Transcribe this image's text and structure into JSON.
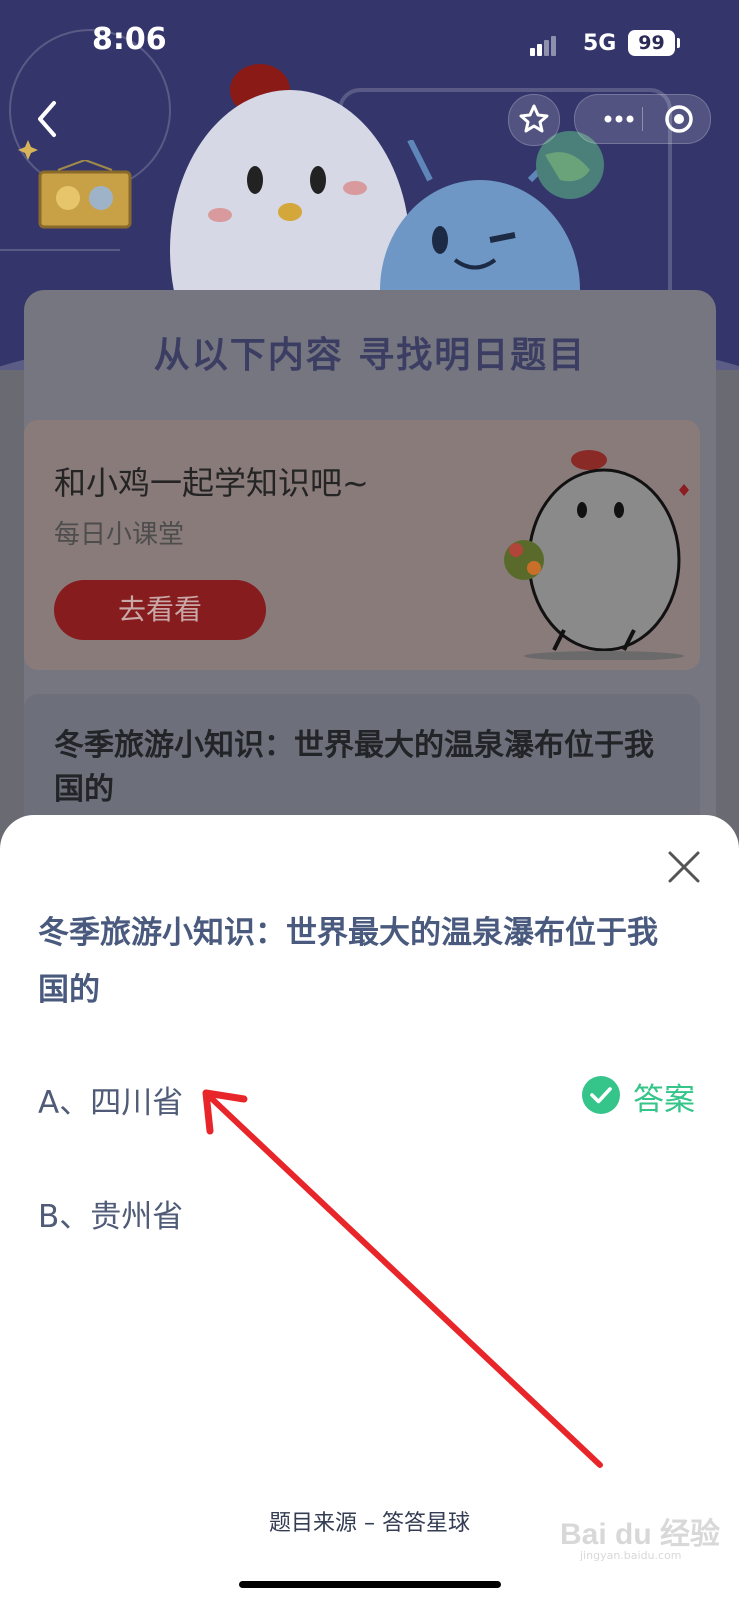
{
  "status_bar": {
    "time": "8:06",
    "network": "5G",
    "battery": "99"
  },
  "background": {
    "section_title": "从以下内容 寻找明日题目",
    "learn_card": {
      "title": "和小鸡一起学知识吧~",
      "subtitle": "每日小课堂",
      "button": "去看看"
    },
    "question_card": {
      "text": "冬季旅游小知识：世界最大的温泉瀑布位于我国的"
    }
  },
  "sheet": {
    "question": "冬季旅游小知识：世界最大的温泉瀑布位于我国的",
    "options": [
      {
        "label": "A、四川省"
      },
      {
        "label": "B、贵州省"
      }
    ],
    "answer_label": "答案",
    "source": "题目来源 – 答答星球"
  },
  "watermark": {
    "text": "Bai du 经验",
    "sub": "jingyan.baidu.com"
  },
  "colors": {
    "answer_green": "#35c48a",
    "question_text": "#4a5a7e",
    "arrow_red": "#e8262a"
  }
}
